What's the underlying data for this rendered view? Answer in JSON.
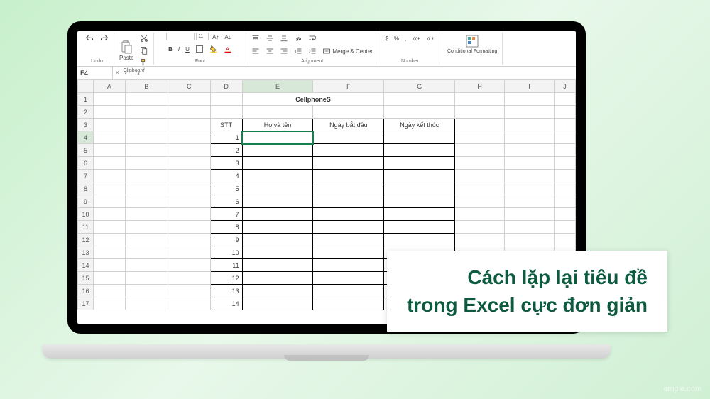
{
  "ribbon": {
    "undo_label": "Undo",
    "paste_label": "Paste",
    "clipboard_label": "Clipboard",
    "font_label": "Font",
    "alignment_label": "Alignment",
    "number_label": "Number",
    "merge_label": "Merge & Center",
    "conditional_label": "Conditional Formatting",
    "font_size": "11",
    "bold": "B",
    "italic": "I",
    "underline": "U",
    "percent": "%",
    "comma": ","
  },
  "formula_bar": {
    "cell_ref": "E4",
    "fx": "fx",
    "value": ""
  },
  "columns": [
    "A",
    "B",
    "C",
    "D",
    "E",
    "F",
    "G",
    "H",
    "I",
    "J"
  ],
  "sheet": {
    "title": "CellphoneS",
    "headers": {
      "stt": "STT",
      "hoten": "Ho và tên",
      "ngaybd": "Ngày bắt đầu",
      "ngaykt": "Ngày kết thúc"
    },
    "stt_values": [
      "1",
      "2",
      "3",
      "4",
      "5",
      "6",
      "7",
      "8",
      "9",
      "10",
      "11",
      "12",
      "13",
      "14"
    ]
  },
  "caption": {
    "line1": "Cách lặp lại tiêu đề",
    "line2": "trong Excel cực đơn giản"
  },
  "watermark": "ample.com"
}
